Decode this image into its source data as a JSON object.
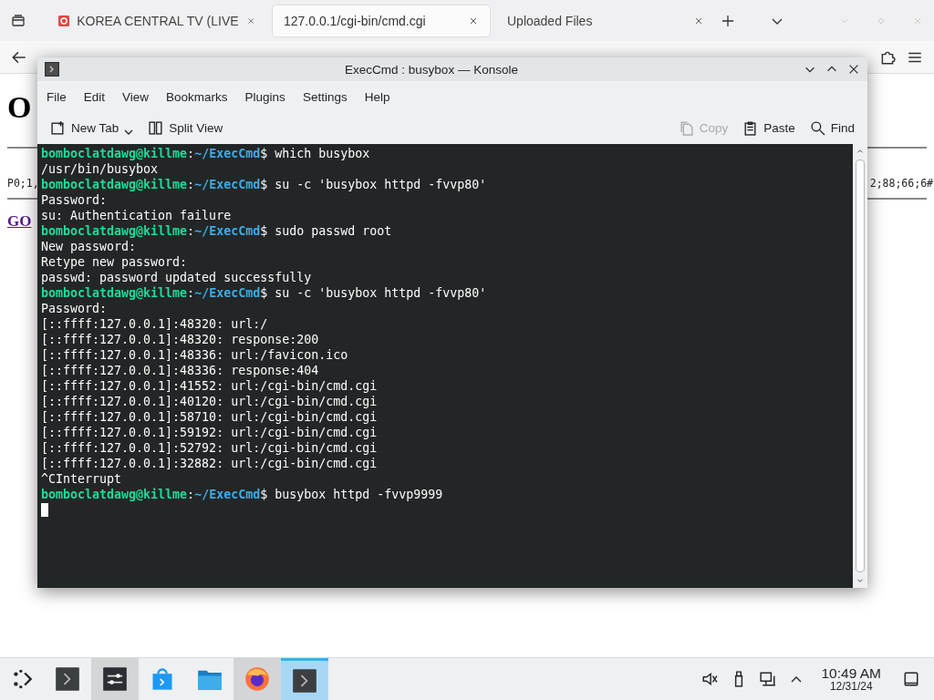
{
  "browser": {
    "tabs": [
      {
        "title": "KOREA CENTRAL TV (LIVE",
        "selected": false,
        "favicon": true
      },
      {
        "title": "127.0.0.1/cgi-bin/cmd.cgi",
        "selected": true,
        "favicon": false
      },
      {
        "title": "Uploaded Files",
        "selected": false,
        "favicon": false
      }
    ],
    "page": {
      "heading": "O",
      "row_left": "P0;1,",
      "row_right": "2;88;66;6#",
      "link": "GO"
    }
  },
  "konsole": {
    "title": "ExecCmd : busybox — Konsole",
    "menu": [
      "File",
      "Edit",
      "View",
      "Bookmarks",
      "Plugins",
      "Settings",
      "Help"
    ],
    "toolbar": [
      {
        "kind": "new-tab",
        "label": "New Tab",
        "disabled": false
      },
      {
        "kind": "split",
        "label": "Split View",
        "disabled": false
      },
      {
        "kind": "copy",
        "label": "Copy",
        "disabled": true
      },
      {
        "kind": "paste",
        "label": "Paste",
        "disabled": false
      },
      {
        "kind": "find",
        "label": "Find",
        "disabled": false
      }
    ],
    "lines": [
      {
        "kind": "prompt",
        "user": "bomboclatdawg@killme",
        "separator": ":",
        "path": "~/ExecCmd",
        "symbol": "$",
        "command": "which busybox"
      },
      {
        "kind": "output",
        "text": "/usr/bin/busybox"
      },
      {
        "kind": "prompt",
        "user": "bomboclatdawg@killme",
        "separator": ":",
        "path": "~/ExecCmd",
        "symbol": "$",
        "command": "su -c 'busybox httpd -fvvp80'"
      },
      {
        "kind": "output",
        "text": "Password:"
      },
      {
        "kind": "output",
        "text": "su: Authentication failure"
      },
      {
        "kind": "prompt",
        "user": "bomboclatdawg@killme",
        "separator": ":",
        "path": "~/ExecCmd",
        "symbol": "$",
        "command": "sudo passwd root"
      },
      {
        "kind": "output",
        "text": "New password:"
      },
      {
        "kind": "output",
        "text": "Retype new password:"
      },
      {
        "kind": "output",
        "text": "passwd: password updated successfully"
      },
      {
        "kind": "prompt",
        "user": "bomboclatdawg@killme",
        "separator": ":",
        "path": "~/ExecCmd",
        "symbol": "$",
        "command": "su -c 'busybox httpd -fvvp80'"
      },
      {
        "kind": "output",
        "text": "Password:"
      },
      {
        "kind": "output",
        "text": "[::ffff:127.0.0.1]:48320: url:/"
      },
      {
        "kind": "output",
        "text": "[::ffff:127.0.0.1]:48320: response:200"
      },
      {
        "kind": "output",
        "text": "[::ffff:127.0.0.1]:48336: url:/favicon.ico"
      },
      {
        "kind": "output",
        "text": "[::ffff:127.0.0.1]:48336: response:404"
      },
      {
        "kind": "output",
        "text": "[::ffff:127.0.0.1]:41552: url:/cgi-bin/cmd.cgi"
      },
      {
        "kind": "output",
        "text": "[::ffff:127.0.0.1]:40120: url:/cgi-bin/cmd.cgi"
      },
      {
        "kind": "output",
        "text": "[::ffff:127.0.0.1]:58710: url:/cgi-bin/cmd.cgi"
      },
      {
        "kind": "output",
        "text": "[::ffff:127.0.0.1]:59192: url:/cgi-bin/cmd.cgi"
      },
      {
        "kind": "output",
        "text": "[::ffff:127.0.0.1]:52792: url:/cgi-bin/cmd.cgi"
      },
      {
        "kind": "output",
        "text": "[::ffff:127.0.0.1]:32882: url:/cgi-bin/cmd.cgi"
      },
      {
        "kind": "output",
        "text": "^CInterrupt"
      },
      {
        "kind": "prompt",
        "user": "bomboclatdawg@killme",
        "separator": ":",
        "path": "~/ExecCmd",
        "symbol": "$",
        "command": "busybox httpd -fvvp9999"
      },
      {
        "kind": "cursor"
      }
    ]
  },
  "taskbar": {
    "apps": [
      {
        "kind": "terminal",
        "open": false,
        "selected": false
      },
      {
        "kind": "settings",
        "open": true,
        "selected": false
      },
      {
        "kind": "store",
        "open": false,
        "selected": false
      },
      {
        "kind": "folder",
        "open": false,
        "selected": false
      },
      {
        "kind": "browser",
        "open": true,
        "selected": false
      },
      {
        "kind": "terminal",
        "open": true,
        "selected": true
      }
    ],
    "time": "10:49 AM",
    "date": "12/31/24"
  }
}
